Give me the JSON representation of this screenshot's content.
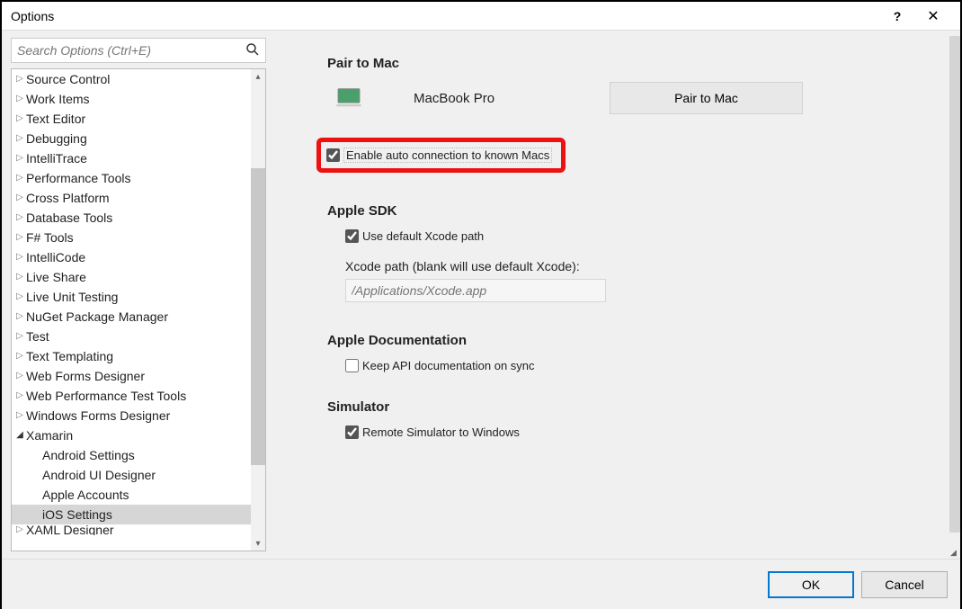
{
  "window": {
    "title": "Options"
  },
  "search": {
    "placeholder": "Search Options (Ctrl+E)"
  },
  "tree": {
    "items": [
      {
        "label": "Source Control",
        "expanded": false,
        "depth": 0
      },
      {
        "label": "Work Items",
        "expanded": false,
        "depth": 0
      },
      {
        "label": "Text Editor",
        "expanded": false,
        "depth": 0
      },
      {
        "label": "Debugging",
        "expanded": false,
        "depth": 0
      },
      {
        "label": "IntelliTrace",
        "expanded": false,
        "depth": 0
      },
      {
        "label": "Performance Tools",
        "expanded": false,
        "depth": 0
      },
      {
        "label": "Cross Platform",
        "expanded": false,
        "depth": 0
      },
      {
        "label": "Database Tools",
        "expanded": false,
        "depth": 0
      },
      {
        "label": "F# Tools",
        "expanded": false,
        "depth": 0
      },
      {
        "label": "IntelliCode",
        "expanded": false,
        "depth": 0
      },
      {
        "label": "Live Share",
        "expanded": false,
        "depth": 0
      },
      {
        "label": "Live Unit Testing",
        "expanded": false,
        "depth": 0
      },
      {
        "label": "NuGet Package Manager",
        "expanded": false,
        "depth": 0
      },
      {
        "label": "Test",
        "expanded": false,
        "depth": 0
      },
      {
        "label": "Text Templating",
        "expanded": false,
        "depth": 0
      },
      {
        "label": "Web Forms Designer",
        "expanded": false,
        "depth": 0
      },
      {
        "label": "Web Performance Test Tools",
        "expanded": false,
        "depth": 0
      },
      {
        "label": "Windows Forms Designer",
        "expanded": false,
        "depth": 0
      },
      {
        "label": "Xamarin",
        "expanded": true,
        "depth": 0
      },
      {
        "label": "Android Settings",
        "depth": 1
      },
      {
        "label": "Android UI Designer",
        "depth": 1
      },
      {
        "label": "Apple Accounts",
        "depth": 1
      },
      {
        "label": "iOS Settings",
        "depth": 1,
        "selected": true
      },
      {
        "label": "XAML Designer",
        "expanded": false,
        "depth": 0,
        "partial": true
      }
    ]
  },
  "pair": {
    "heading": "Pair to Mac",
    "mac_name": "MacBook Pro",
    "button": "Pair to Mac",
    "enable_auto": "Enable auto connection to known Macs"
  },
  "sdk": {
    "heading": "Apple SDK",
    "use_default": "Use default Xcode path",
    "xcode_label": "Xcode path (blank will use default Xcode):",
    "xcode_placeholder": "/Applications/Xcode.app"
  },
  "doc": {
    "heading": "Apple Documentation",
    "keep_sync": "Keep API documentation on sync"
  },
  "sim": {
    "heading": "Simulator",
    "remote": "Remote Simulator to Windows"
  },
  "footer": {
    "ok": "OK",
    "cancel": "Cancel"
  }
}
